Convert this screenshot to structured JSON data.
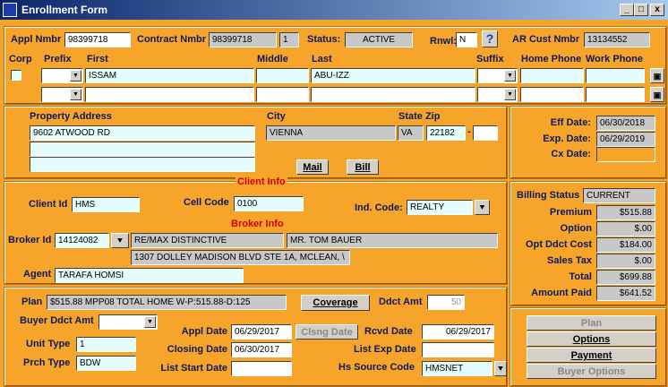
{
  "window": {
    "title": "Enrollment Form",
    "min": "_",
    "max": "□",
    "close": "x"
  },
  "top": {
    "appl_nmbr_label": "Appl Nmbr",
    "appl_nmbr": "98399718",
    "contract_label": "Contract Nmbr",
    "contract": "98399718",
    "contract_seq": "1",
    "status_label": "Status:",
    "status": "ACTIVE",
    "rnwl_label": "Rnwl:",
    "rnwl": "N",
    "help": "?",
    "ar_label": "AR Cust Nmbr",
    "ar": "13134552"
  },
  "names": {
    "corp": "Corp",
    "prefix": "Prefix",
    "first": "First",
    "middle": "Middle",
    "last": "Last",
    "suffix": "Suffix",
    "home_phone": "Home Phone",
    "work_phone": "Work Phone",
    "row1_first": "ISSAM",
    "row1_last": "ABU-IZZ"
  },
  "property": {
    "addr_label": "Property Address",
    "city_label": "City",
    "state_zip_label": "State Zip",
    "addr1": "9602 ATWOOD RD",
    "city": "VIENNA",
    "state": "VA",
    "zip": "22182",
    "dash": "-",
    "mail": "Mail",
    "bill": "Bill"
  },
  "dates": {
    "eff_label": "Eff Date:",
    "eff": "06/30/2018",
    "exp_label": "Exp. Date:",
    "exp": "06/29/2019",
    "cx_label": "Cx Date:"
  },
  "client": {
    "section": "Client Info",
    "id_label": "Client Id",
    "id": "HMS",
    "cell_label": "Cell Code",
    "cell": "0100",
    "ind_label": "Ind. Code:",
    "ind": "REALTY"
  },
  "broker": {
    "section": "Broker Info",
    "id_label": "Broker Id",
    "id": "14124082",
    "name": "RE/MAX DISTINCTIVE",
    "contact": "MR. TOM BAUER",
    "address": "1307 DOLLEY MADISON BLVD STE 1A, MCLEAN, \\",
    "agent_label": "Agent",
    "agent": "TARAFA  HOMSI"
  },
  "billing": {
    "status_label": "Billing Status",
    "status": "CURRENT",
    "premium_label": "Premium",
    "premium": "$515.88",
    "option_label": "Option",
    "option": "$.00",
    "opt_ddct_label": "Opt Ddct Cost",
    "opt_ddct": "$184.00",
    "tax_label": "Sales Tax",
    "tax": "$.00",
    "total_label": "Total",
    "total": "$699.88",
    "paid_label": "Amount Paid",
    "paid": "$641.52"
  },
  "plan": {
    "plan_label": "Plan",
    "plan": "$515.88 MPP08 TOTAL HOME W-P:515.88-D:125",
    "coverage": "Coverage",
    "ddct_label": "Ddct Amt",
    "ddct": "50",
    "buyer_ddct_label": "Buyer Ddct Amt",
    "unit_type_label": "Unit Type",
    "unit_type": "1",
    "prch_type_label": "Prch Type",
    "prch_type": "BDW",
    "appl_date_label": "Appl Date",
    "appl_date": "06/29/2017",
    "clsng_btn": "Clsng Date",
    "rcvd_label": "Rcvd Date",
    "rcvd": "06/29/2017",
    "closing_label": "Closing Date",
    "closing": "06/30/2017",
    "list_exp_label": "List Exp Date",
    "list_start_label": "List Start Date",
    "hs_label": "Hs Source Code",
    "hs": "HMSNET"
  },
  "actions": {
    "plan": "Plan",
    "options": "Options",
    "payment": "Payment",
    "buyer_options": "Buyer Options"
  }
}
